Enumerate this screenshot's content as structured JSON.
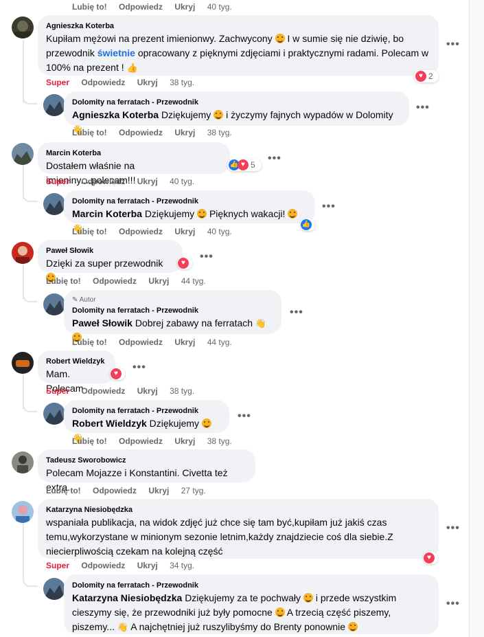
{
  "colors": {
    "accent": "#216fdb",
    "super": "#e41e3f",
    "bubble": "#f0f2f5",
    "muted": "#65676b"
  },
  "actions": {
    "like": "Lubię to!",
    "reply": "Odpowiedz",
    "hide": "Ukryj",
    "super": "Super"
  },
  "top_row": {
    "time": "40 tyg."
  },
  "page_name": "Dolomity na ferratach - Przewodnik",
  "author_tag": "Autor",
  "comments": [
    {
      "author": "Agnieszka Koterba",
      "text_a": "Kupiłam mężowi na prezent imienionwy. Zachwycony",
      "text_b": "I w sumie się nie dziwię, bo przewodnik",
      "link": "świetnie",
      "text_c": "opracowany z pięknymi zdjęciami i praktycznymi radami. Polecam w 100% na prezent !",
      "reaction_count": "2",
      "time": "38 tyg.",
      "reply": {
        "mention": "Agnieszka Koterba",
        "text_a": "Dziękujemy",
        "text_b": "i życzymy fajnych wypadów w Dolomity",
        "time": "38 tyg."
      }
    },
    {
      "author": "Marcin Koterba",
      "text": "Dostałem właśnie na imieniny....polecam!!!",
      "reaction_count": "5",
      "time": "40 tyg.",
      "reply": {
        "mention": "Marcin Koterba",
        "text_a": "Dziękujemy",
        "text_b": "Pięknych wakacji!",
        "time": "40 tyg."
      }
    },
    {
      "author": "Paweł Słowik",
      "text": "Dzięki za super przewodnik",
      "time": "44 tyg.",
      "reply": {
        "mention": "Paweł Słowik",
        "text_a": "Dobrej zabawy na ferratach",
        "time": "44 tyg."
      }
    },
    {
      "author": "Robert Wieldzyk",
      "text": "Mam. Polecam",
      "time": "38 tyg.",
      "reply": {
        "mention": "Robert Wieldzyk",
        "text_a": "Dziękujemy",
        "time": "38 tyg."
      }
    },
    {
      "author": "Tadeusz Sworobowicz",
      "text": "Polecam Mojazze i Konstantini. Civetta też extra.",
      "time": "27 tyg."
    },
    {
      "author": "Katarzyna Niesiobędzka",
      "text": "wspaniała publikacja, na widok zdjęć już chce się tam być,kupiłam już jakiś czas temu,wykorzystane w minionym sezonie letnim,każdy znajdziecie coś dla siebie.Z niecierpliwością czekam na kolejną część",
      "time": "34 tyg.",
      "reply": {
        "mention": "Katarzyna Niesiobędzka",
        "text_a": "Dziękujemy za te pochwały",
        "text_b": "i przede wszystkim cieszymy się, że przewodniki już były pomocne",
        "text_c": "A trzecią część piszemy, piszemy...",
        "text_d": "A najchętniej już ruszylibyśmy do Brenty ponownie"
      }
    }
  ]
}
